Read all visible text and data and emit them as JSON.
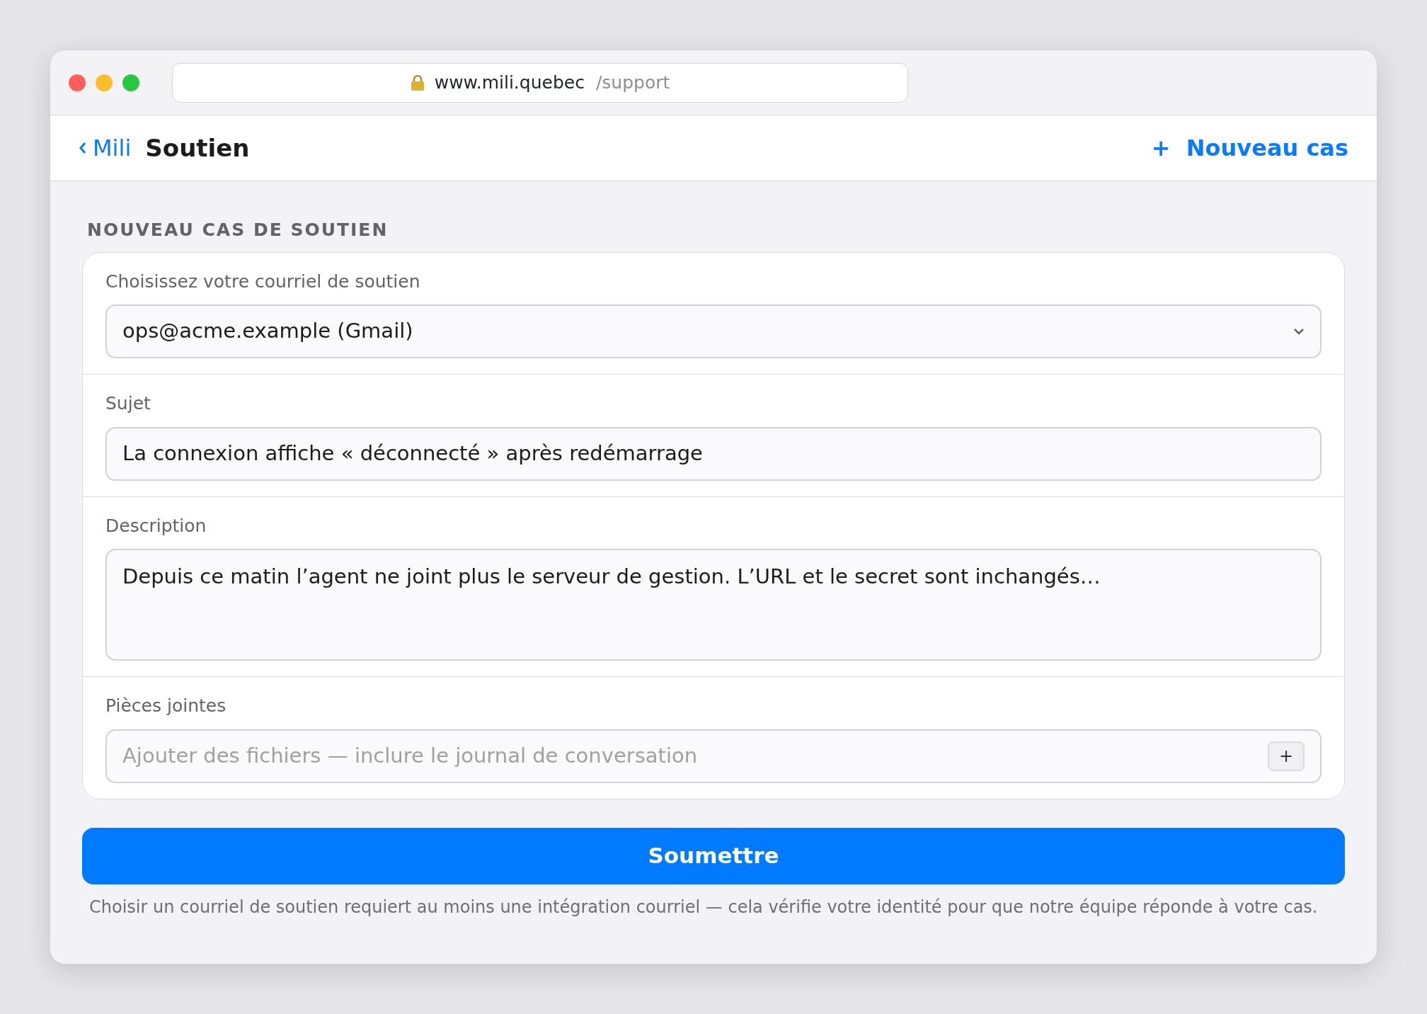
{
  "browser": {
    "url_host": "www.mili.quebec",
    "url_path": "/support"
  },
  "header": {
    "back_label": "Mili",
    "title": "Soutien",
    "action_label": "Nouveau cas",
    "action_icon": "+"
  },
  "section_title": "NOUVEAU CAS DE SOUTIEN",
  "fields": [
    {
      "kind": "select",
      "label": "Choisissez votre courriel de soutien",
      "value": "ops@acme.example (Gmail)"
    },
    {
      "kind": "text",
      "label": "Sujet",
      "value": "La connexion affiche « déconnecté » après redémarrage"
    },
    {
      "kind": "textarea",
      "label": "Description",
      "value": "Depuis ce matin l’agent ne joint plus le serveur de gestion. L’URL et le secret sont inchangés…"
    },
    {
      "kind": "attach",
      "label": "Pièces jointes",
      "placeholder": "Ajouter des fichiers — inclure le journal de conversation",
      "button": "+"
    }
  ],
  "submit": "Soumettre",
  "footnote": "Choisir un courriel de soutien requiert au moins une intégration courriel — cela vérifie votre identité pour que notre équipe réponde à votre cas."
}
